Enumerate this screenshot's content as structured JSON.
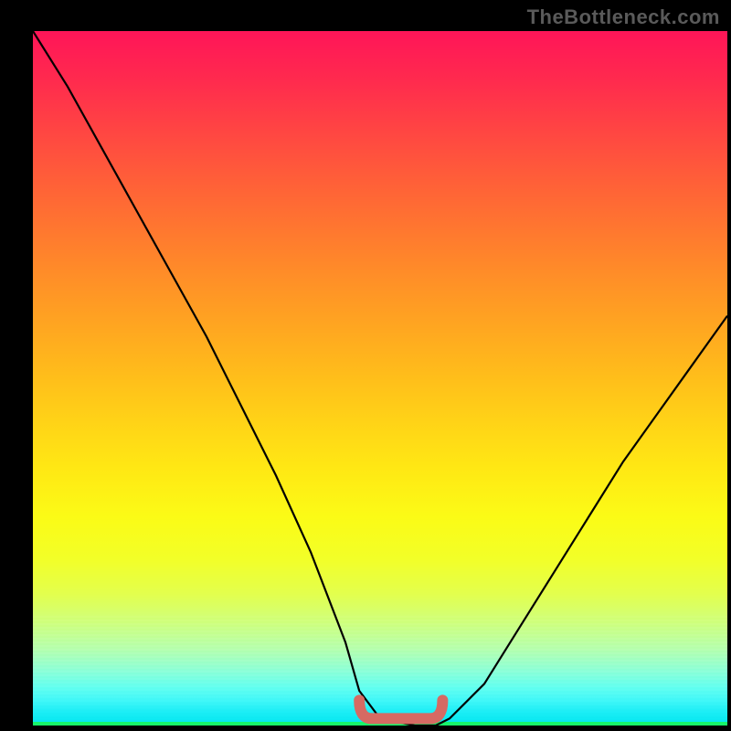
{
  "watermark": "TheBottleneck.com",
  "chart_data": {
    "type": "line",
    "title": "",
    "xlabel": "",
    "ylabel": "",
    "xlim": [
      0,
      100
    ],
    "ylim": [
      0,
      100
    ],
    "grid": false,
    "legend": false,
    "series": [
      {
        "name": "bottleneck-curve",
        "x": [
          0,
          5,
          10,
          15,
          20,
          25,
          30,
          35,
          40,
          45,
          47,
          50,
          55,
          58,
          60,
          65,
          70,
          75,
          80,
          85,
          90,
          95,
          100
        ],
        "y": [
          100,
          92,
          83,
          74,
          65,
          56,
          46,
          36,
          25,
          12,
          5,
          1,
          0,
          0,
          1,
          6,
          14,
          22,
          30,
          38,
          45,
          52,
          59
        ]
      }
    ],
    "annotations": [
      {
        "name": "valley-marker",
        "shape": "flat-u",
        "x_range": [
          47,
          59
        ],
        "y": 1,
        "color": "#d66a63"
      }
    ],
    "background_gradient": {
      "orientation": "vertical",
      "stops": [
        {
          "pos": 0.0,
          "color": "#ff1558"
        },
        {
          "pos": 0.35,
          "color": "#ff8d28"
        },
        {
          "pos": 0.63,
          "color": "#ffe814"
        },
        {
          "pos": 0.85,
          "color": "#d0ff7b"
        },
        {
          "pos": 1.0,
          "color": "#00e6f0"
        }
      ]
    }
  }
}
